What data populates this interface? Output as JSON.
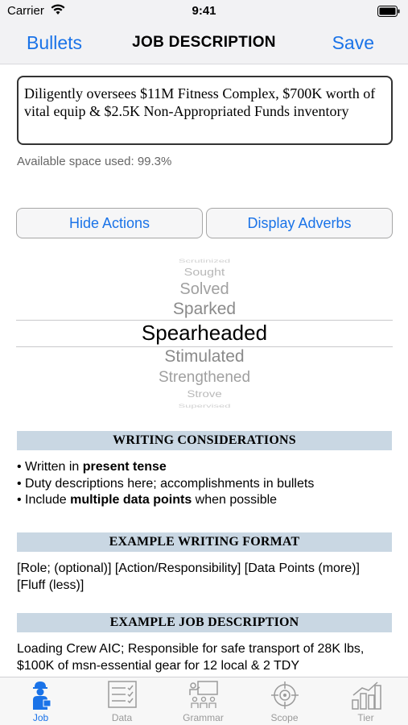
{
  "status_bar": {
    "carrier": "Carrier",
    "time": "9:41"
  },
  "nav": {
    "left": "Bullets",
    "title": "JOB DESCRIPTION",
    "right": "Save"
  },
  "editor": {
    "value": "Diligently oversees $11M Fitness Complex, $700K worth of vital equip & $2.5K Non-Appropriated Funds inventory"
  },
  "space_used": "Available space used: 99.3%",
  "buttons": {
    "hide_actions": "Hide Actions",
    "display_adverbs": "Display Adverbs"
  },
  "picker": {
    "items": [
      "Scrutinized",
      "Sought",
      "Solved",
      "Sparked",
      "Spearheaded",
      "Stimulated",
      "Strengthened",
      "Strove",
      "Supervised"
    ],
    "selected": "Spearheaded"
  },
  "sections": {
    "writing_considerations": {
      "title": "WRITING CONSIDERATIONS",
      "bullets": [
        {
          "pre": "• Written in ",
          "bold": "present tense",
          "post": ""
        },
        {
          "pre": "• Duty descriptions here; accomplishments in bullets",
          "bold": "",
          "post": ""
        },
        {
          "pre": "• Include ",
          "bold": "multiple data points",
          "post": " when possible"
        }
      ]
    },
    "example_format": {
      "title": "EXAMPLE WRITING FORMAT",
      "text": "[Role; (optional)] [Action/Responsibility] [Data Points (more)] [Fluff (less)]"
    },
    "example_job": {
      "title": "EXAMPLE JOB DESCRIPTION",
      "text": "Loading Crew AIC; Responsible for safe transport of 28K lbs, $100K of msn-essential gear for 12 local & 2 TDY"
    }
  },
  "tabs": [
    {
      "label": "Job",
      "icon": "worker-icon",
      "active": true
    },
    {
      "label": "Data",
      "icon": "checklist-icon",
      "active": false
    },
    {
      "label": "Grammar",
      "icon": "classroom-icon",
      "active": false
    },
    {
      "label": "Scope",
      "icon": "crosshair-icon",
      "active": false
    },
    {
      "label": "Tier",
      "icon": "bar-chart-icon",
      "active": false
    }
  ],
  "colors": {
    "accent": "#1a73e8",
    "section_header": "#c9d7e3",
    "tab_inactive": "#9a9a9a"
  }
}
